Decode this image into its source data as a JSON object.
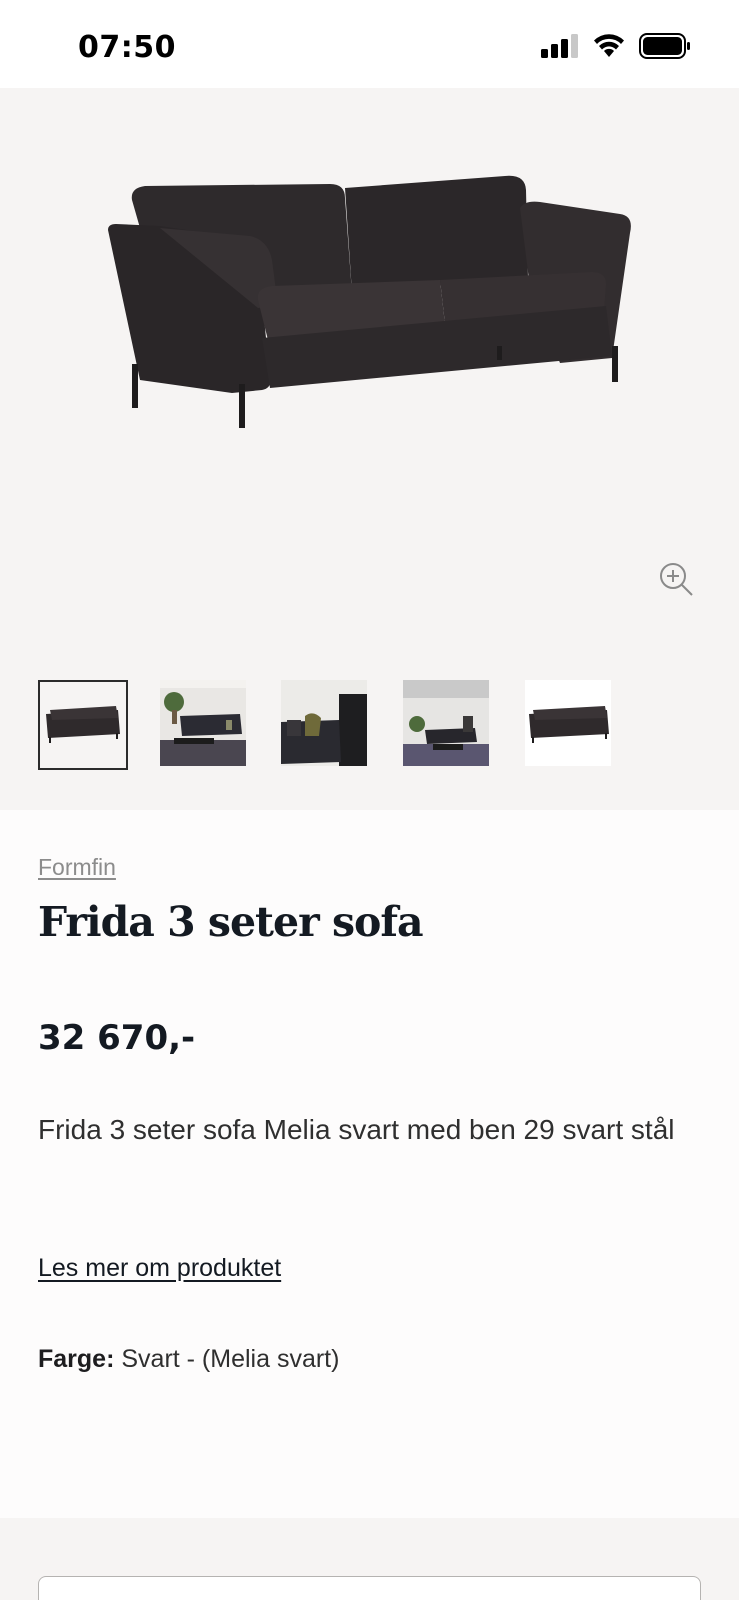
{
  "status_bar": {
    "time": "07:50",
    "signal_icon": "cellular-signal-icon",
    "wifi_icon": "wifi-icon",
    "battery_icon": "battery-icon"
  },
  "gallery": {
    "hero_alt": "sofa-image",
    "zoom_icon": "zoom-in-icon",
    "thumbnails": [
      {
        "name": "sofa-front",
        "selected": true
      },
      {
        "name": "living-room-1",
        "selected": false
      },
      {
        "name": "living-room-2",
        "selected": false
      },
      {
        "name": "living-room-3",
        "selected": false
      },
      {
        "name": "sofa-white-bg",
        "selected": false
      }
    ]
  },
  "product": {
    "brand": "Formfin",
    "title": "Frida 3 seter sofa",
    "price": "32 670,-",
    "description": "Frida 3 seter sofa Melia svart med ben 29 svart stål",
    "read_more": "Les mer om produktet",
    "color_label": "Farge:",
    "color_value": "Svart - (Melia svart)"
  },
  "colors": {
    "page_bg": "#fdfcfc",
    "gallery_bg": "#f6f4f3",
    "text_dark": "#141a22",
    "sofa": "#2f2a2c"
  }
}
